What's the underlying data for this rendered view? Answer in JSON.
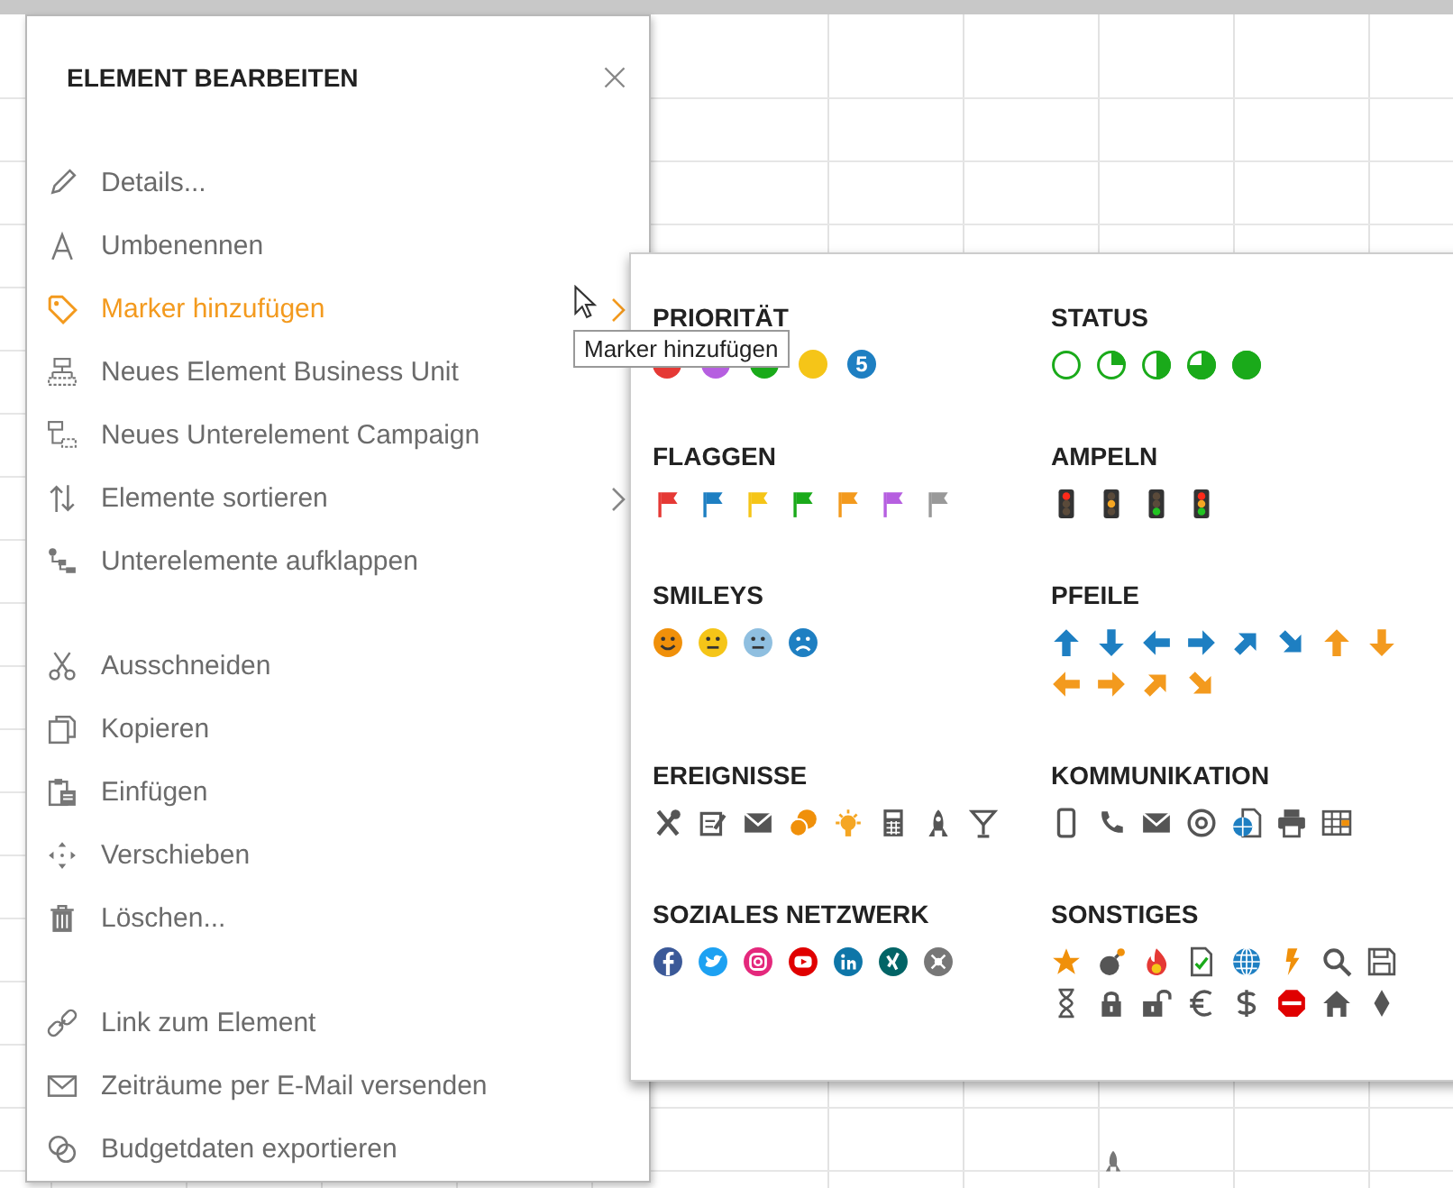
{
  "dialog": {
    "title": "ELEMENT BEARBEITEN"
  },
  "menu": {
    "sections": [
      {
        "items": [
          {
            "label": "Details...",
            "selected": false,
            "submenu": false
          },
          {
            "label": "Umbenennen",
            "selected": false,
            "submenu": false
          },
          {
            "label": "Marker hinzufügen",
            "selected": true,
            "submenu": true
          },
          {
            "label": "Neues Element Business Unit",
            "selected": false,
            "submenu": false
          },
          {
            "label": "Neues Unterelement Campaign",
            "selected": false,
            "submenu": false
          },
          {
            "label": "Elemente sortieren",
            "selected": false,
            "submenu": true
          },
          {
            "label": "Unterelemente aufklappen",
            "selected": false,
            "submenu": false
          }
        ]
      },
      {
        "items": [
          {
            "label": "Ausschneiden",
            "selected": false,
            "submenu": false
          },
          {
            "label": "Kopieren",
            "selected": false,
            "submenu": false
          },
          {
            "label": "Einfügen",
            "selected": false,
            "submenu": false
          },
          {
            "label": "Verschieben",
            "selected": false,
            "submenu": false
          },
          {
            "label": "Löschen...",
            "selected": false,
            "submenu": false
          }
        ]
      },
      {
        "items": [
          {
            "label": "Link zum Element",
            "selected": false,
            "submenu": false
          },
          {
            "label": "Zeiträume per E-Mail versenden",
            "selected": false,
            "submenu": false
          },
          {
            "label": "Budgetdaten exportieren",
            "selected": false,
            "submenu": false
          }
        ]
      }
    ]
  },
  "marker_groups": [
    {
      "title": "PRIORITÄT",
      "kind": "priority",
      "items": [
        {
          "color": "#e53935"
        },
        {
          "color": "#b65fe0"
        },
        {
          "color": "#1aaa1a"
        },
        {
          "color": "#f5c518"
        },
        {
          "color": "#1e7fc2",
          "label": "5"
        }
      ]
    },
    {
      "title": "STATUS",
      "kind": "status"
    },
    {
      "title": "FLAGGEN",
      "kind": "flags",
      "items": [
        {
          "color": "#e53935"
        },
        {
          "color": "#1e7fc2"
        },
        {
          "color": "#f5c518"
        },
        {
          "color": "#1aaa1a"
        },
        {
          "color": "#f39a1e"
        },
        {
          "color": "#b65fe0"
        },
        {
          "color": "#999999"
        }
      ]
    },
    {
      "title": "AMPELN",
      "kind": "traffic_lights"
    },
    {
      "title": "SMILEYS",
      "kind": "smileys"
    },
    {
      "title": "PFEILE",
      "kind": "arrows"
    },
    {
      "title": "EREIGNISSE",
      "kind": "events"
    },
    {
      "title": "KOMMUNIKATION",
      "kind": "communication"
    },
    {
      "title": "SOZIALES NETZWERK",
      "kind": "social"
    },
    {
      "title": "SONSTIGES",
      "kind": "misc"
    }
  ],
  "tooltip": {
    "text": "Marker hinzufügen"
  }
}
